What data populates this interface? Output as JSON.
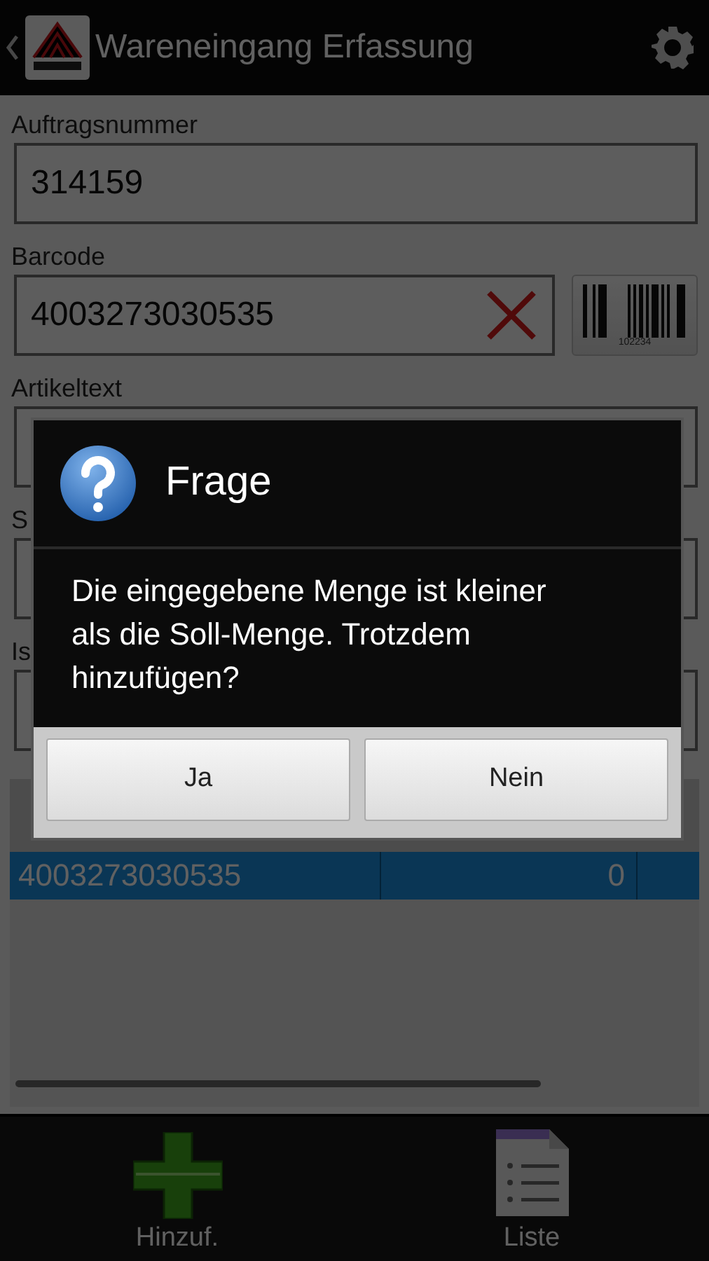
{
  "action_bar": {
    "title": "Wareneingang Erfassung"
  },
  "form": {
    "fields": [
      {
        "label": "Auftragsnummer",
        "value": "314159",
        "kind": "plain"
      },
      {
        "label": "Barcode",
        "value": "4003273030535",
        "kind": "scan"
      },
      {
        "label": "Artikeltext",
        "kind": "plain"
      },
      {
        "label": "S",
        "kind": "plain"
      },
      {
        "label": "Is",
        "kind": "plain"
      }
    ],
    "scan_button_caption": "102234"
  },
  "table": {
    "rows": [
      {
        "cells": [
          "4003273030535",
          "0"
        ],
        "selected": true
      }
    ]
  },
  "dialog": {
    "title": "Frage",
    "message": "Die eingegebene Menge ist kleiner als die Soll-Menge. Trotzdem hinzufügen?",
    "buttons": [
      "Ja",
      "Nein"
    ]
  },
  "bottom_bar": {
    "actions": [
      {
        "label": "Hinzuf.",
        "kind": "add"
      },
      {
        "label": "Liste",
        "kind": "list"
      }
    ]
  }
}
